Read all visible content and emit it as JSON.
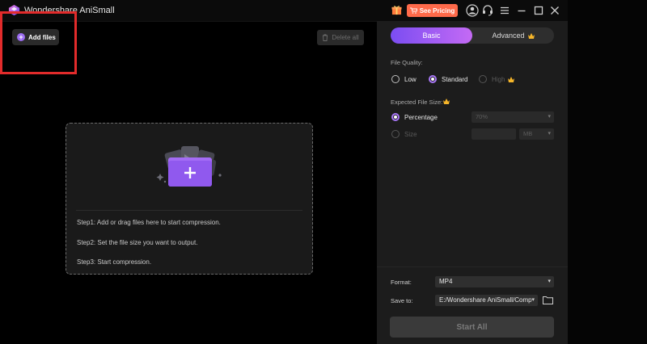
{
  "titlebar": {
    "app_title": "Wondershare AniSmall",
    "pricing_label": "See Pricing"
  },
  "toolbar": {
    "add_files_label": "Add files",
    "delete_all_label": "Delete all"
  },
  "dropzone": {
    "steps": [
      "Step1: Add or drag files here to start compression.",
      "Step2: Set the file size you want to output.",
      "Step3: Start compression."
    ]
  },
  "panel": {
    "tabs": {
      "basic": "Basic",
      "advanced": "Advanced"
    },
    "file_quality_label": "File Quality:",
    "quality_options": [
      "Low",
      "Standard",
      "High"
    ],
    "quality_selected": "Standard",
    "expected_size_label": "Expected File Size:",
    "percentage_label": "Percentage",
    "percentage_value": "70%",
    "size_label": "Size",
    "size_unit": "MB",
    "format_label": "Format:",
    "format_value": "MP4",
    "save_to_label": "Save to:",
    "save_to_value": "E:/Wondershare AniSmall/Comp",
    "start_all_label": "Start All"
  },
  "colors": {
    "accent_purple": "#a877f7",
    "pricing_orange": "#ff6a4a",
    "highlight_red": "#e22b2b"
  }
}
